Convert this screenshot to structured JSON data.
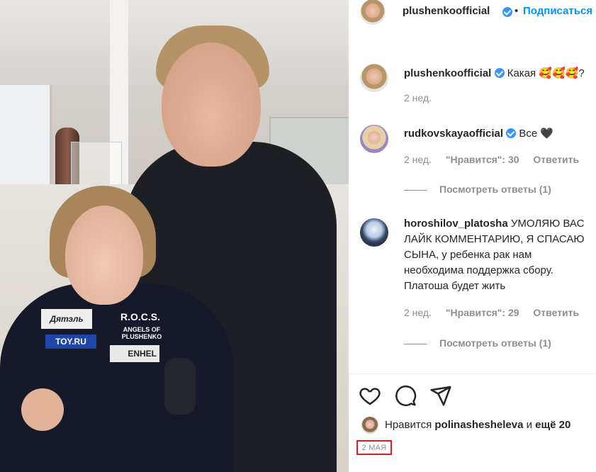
{
  "header": {
    "username": "plushenkoofficial",
    "verified_icon": "verified-badge-icon",
    "separator": "•",
    "follow_label": "Подписаться"
  },
  "photo": {
    "patches": {
      "patch1": "Дятэль",
      "patch2": "TOY.RU",
      "patch3": "R.O.C.S.",
      "patch4": "ANGELS OF PLUSHENKO",
      "patch5": "ENHEL"
    }
  },
  "comments": [
    {
      "username": "plushenkoofficial",
      "verified": true,
      "text": "Какая 🥰🥰🥰?",
      "time": "2 нед."
    },
    {
      "username": "rudkovskayaofficial",
      "verified": true,
      "text": "Все 🖤",
      "time": "2 нед.",
      "likes": "\"Нравится\": 30",
      "reply": "Ответить",
      "view_replies": "Посмотреть ответы (1)"
    },
    {
      "username": "horoshilov_platosha",
      "verified": false,
      "text": "УМОЛЯЮ ВАС ЛАЙК КОММЕНТАРИЮ, Я СПАСАЮ СЫНА, у ребенка рак нам необходима поддержка сбору. Платоша будет жить",
      "time": "2 нед.",
      "likes": "\"Нравится\": 29",
      "reply": "Ответить",
      "view_replies": "Посмотреть ответы (1)"
    }
  ],
  "actions": {
    "like_icon": "heart-icon",
    "comment_icon": "comment-bubble-icon",
    "share_icon": "paper-plane-icon"
  },
  "likes_summary": {
    "prefix": "Нравится",
    "liker": "polinasheshеleva",
    "connector": "и",
    "rest": "ещё 20"
  },
  "post_date": "2 МАЯ",
  "colors": {
    "link_blue": "#0095f6",
    "verified_blue": "#3897f0",
    "secondary_text": "#8e8e8e",
    "highlight_red": "#d61f26"
  }
}
